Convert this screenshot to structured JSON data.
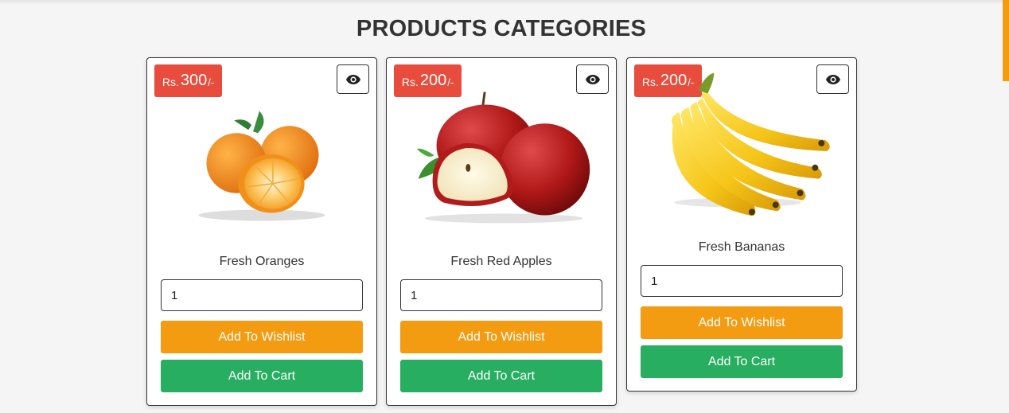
{
  "page": {
    "title": "PRODUCTS CATEGORIES"
  },
  "colors": {
    "price_badge": "#e74c3c",
    "wishlist": "#f39c12",
    "cart": "#27ae60",
    "accent": "#f39c12"
  },
  "products": [
    {
      "currency": "Rs.",
      "price": "300",
      "suffix": "/-",
      "name": "Fresh Oranges",
      "quantity": "1",
      "wishlist_label": "Add To Wishlist",
      "cart_label": "Add To Cart",
      "view_icon": "eye-icon"
    },
    {
      "currency": "Rs.",
      "price": "200",
      "suffix": "/-",
      "name": "Fresh Red Apples",
      "quantity": "1",
      "wishlist_label": "Add To Wishlist",
      "cart_label": "Add To Cart",
      "view_icon": "eye-icon"
    },
    {
      "currency": "Rs.",
      "price": "200",
      "suffix": "/-",
      "name": "Fresh Bananas",
      "quantity": "1",
      "wishlist_label": "Add To Wishlist",
      "cart_label": "Add To Cart",
      "view_icon": "eye-icon"
    }
  ]
}
